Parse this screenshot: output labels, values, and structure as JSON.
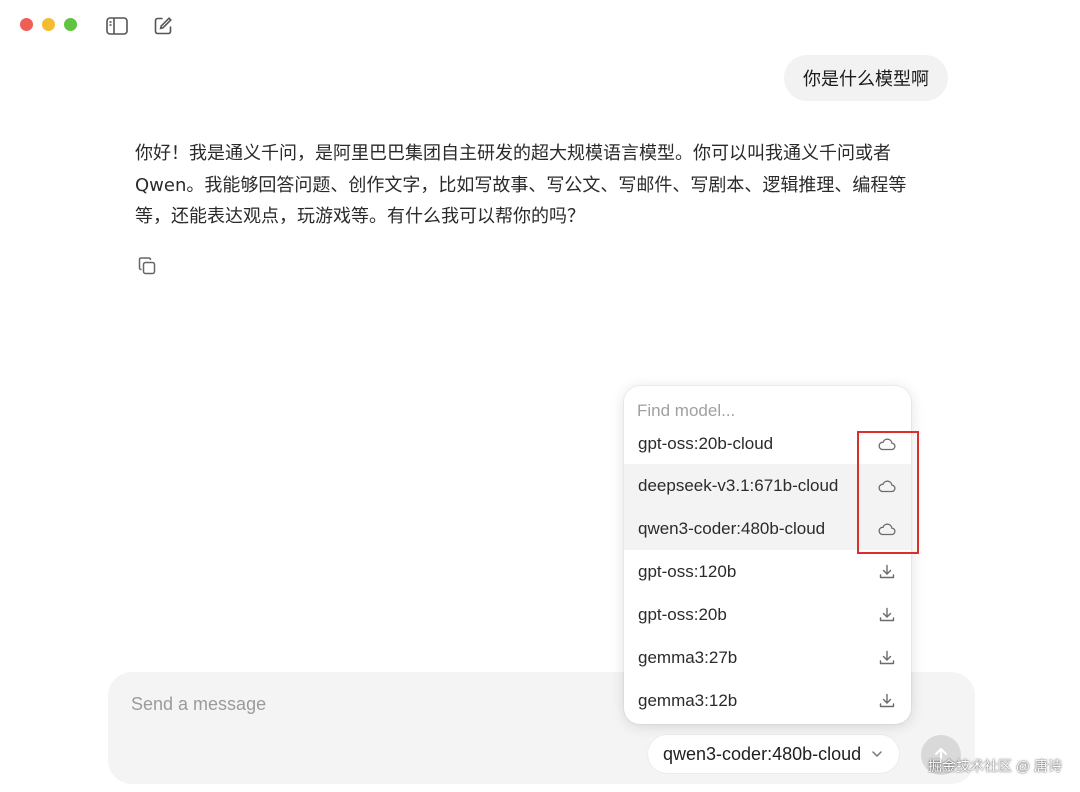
{
  "window": {
    "controls": [
      "close",
      "minimize",
      "maximize"
    ],
    "toolbar_icons": [
      "sidebar-toggle-icon",
      "new-chat-icon"
    ]
  },
  "conversation": {
    "user_message": "你是什么模型啊",
    "assistant_lines": [
      "你好！我是通义千问，是阿里巴巴集团自主研发的超大规模语言模型。你可以叫我通义千问或者",
      "Qwen。我能够回答问题、创作文字，比如写故事、写公文、写邮件、写剧本、逻辑推理、编程等",
      "等，还能表达观点，玩游戏等。有什么我可以帮你的吗？"
    ]
  },
  "model_picker": {
    "search_placeholder": "Find model...",
    "models": [
      {
        "name": "gpt-oss:20b-cloud",
        "icon": "cloud-icon",
        "highlighted": false
      },
      {
        "name": "deepseek-v3.1:671b-cloud",
        "icon": "cloud-icon",
        "highlighted": true
      },
      {
        "name": "qwen3-coder:480b-cloud",
        "icon": "cloud-icon",
        "highlighted": true
      },
      {
        "name": "gpt-oss:120b",
        "icon": "download-icon",
        "highlighted": false
      },
      {
        "name": "gpt-oss:20b",
        "icon": "download-icon",
        "highlighted": false
      },
      {
        "name": "gemma3:27b",
        "icon": "download-icon",
        "highlighted": false
      },
      {
        "name": "gemma3:12b",
        "icon": "download-icon",
        "highlighted": false
      }
    ]
  },
  "composer": {
    "placeholder": "Send a message",
    "selected_model": "qwen3-coder:480b-cloud"
  },
  "annotation": {
    "color": "#d9302c"
  },
  "watermark": "掘金技术社区 @ 唐诗",
  "colors": {
    "close": "#ee5f57",
    "minimize": "#f4bd31",
    "maximize": "#5fc441"
  }
}
